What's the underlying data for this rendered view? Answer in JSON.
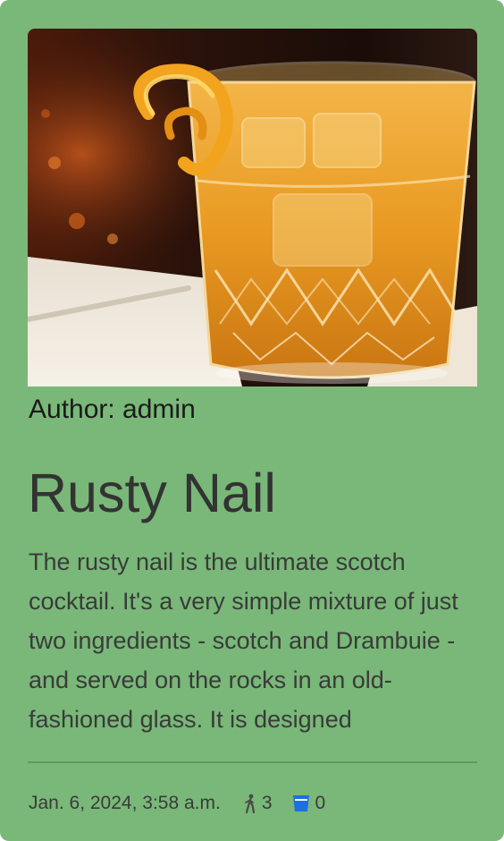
{
  "card": {
    "image_alt": "Rusty Nail cocktail in a crystal glass with orange peel",
    "author_prefix": "Author:",
    "author": "admin",
    "author_line": "Author: admin",
    "title": "Rusty Nail",
    "description": "The rusty nail is the ultimate scotch cocktail. It's a very simple mixture of just two ingredients - scotch and Drambuie - and served on the rocks in an old-fashioned glass. It is designed",
    "footer": {
      "date": "Jan. 6, 2024, 3:58 a.m.",
      "views_icon": "walking-person-icon",
      "views": "3",
      "drinks_icon": "glass-icon",
      "drinks": "0"
    }
  },
  "colors": {
    "card_background": "#79b878",
    "glass_icon": "#1e6fe0"
  }
}
